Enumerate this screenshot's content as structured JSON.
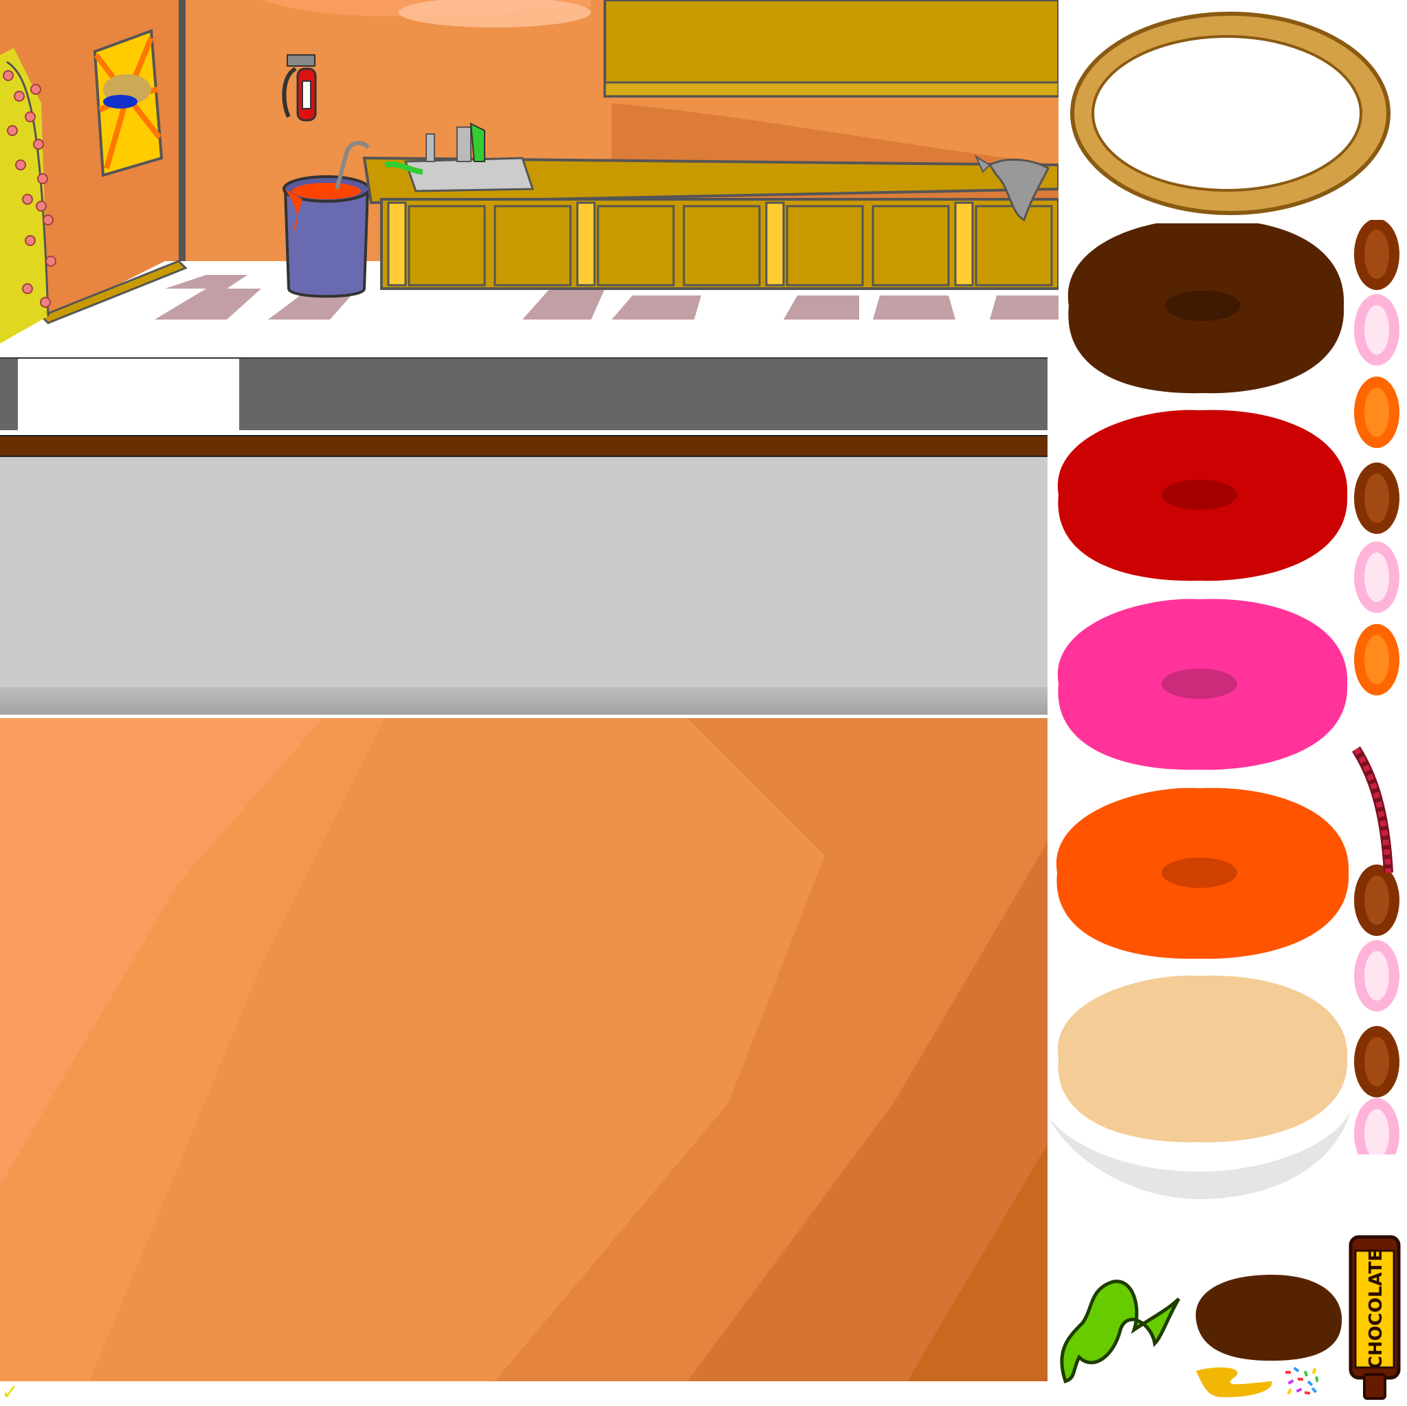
{
  "sprite_sheet": {
    "background": "#ffffff",
    "kitchen": {
      "wall_color": "#ee9149",
      "cabinet_color": "#c99a00",
      "floor_tile_color": "#b78f95"
    },
    "hud": {
      "panel_color": "#666666",
      "stripe_color": "#6a2e03",
      "counter_color": "#cbcbcb",
      "counter_shadow_color": "#a3a3a3"
    },
    "backdrop": {
      "color_light": "#f99d5e",
      "color_dark": "#c8691f"
    },
    "sprites": {
      "pizza_crust": {
        "color": "#d4a147"
      },
      "sauces": [
        {
          "name": "chocolate",
          "color": "#562300",
          "spot": "#3f1902"
        },
        {
          "name": "red",
          "color": "#cc0101",
          "spot": "#a50000"
        },
        {
          "name": "pink",
          "color": "#ff3399",
          "spot": "#cc2a7a"
        },
        {
          "name": "orange",
          "color": "#ff5500",
          "spot": "#d04000"
        },
        {
          "name": "cream",
          "color": "#f4cc96",
          "spot": "#f4cc96"
        }
      ],
      "jelly_beans": [
        {
          "name": "brown",
          "color": "#833100",
          "highlight": "#a24a13"
        },
        {
          "name": "pink",
          "color": "#ffb3d9",
          "highlight": "#ffe5f2"
        },
        {
          "name": "orange",
          "color": "#ff6600",
          "highlight": "#ff8a1d"
        },
        {
          "name": "brown",
          "color": "#833100",
          "highlight": "#a24a13"
        },
        {
          "name": "pink",
          "color": "#ffb3d9",
          "highlight": "#ffe5f2"
        },
        {
          "name": "orange",
          "color": "#ff6600",
          "highlight": "#ff8a1d"
        }
      ],
      "licorice": {
        "color": "#c8203f"
      },
      "seaweed": {
        "color": "#66cc00"
      },
      "chocolate_bottle": {
        "label": "CHOCOLATE",
        "label_color": "#ffcc00",
        "bottle_color": "#661a00"
      },
      "sprinkles": {
        "colors": [
          "#ff3333",
          "#3399ff",
          "#33cc33",
          "#ffcc00",
          "#cc33ff"
        ]
      },
      "cheese_squiggle": {
        "color": "#f2b705"
      },
      "checkmark": {
        "glyph": "✓",
        "color": "#dddd00"
      }
    }
  }
}
